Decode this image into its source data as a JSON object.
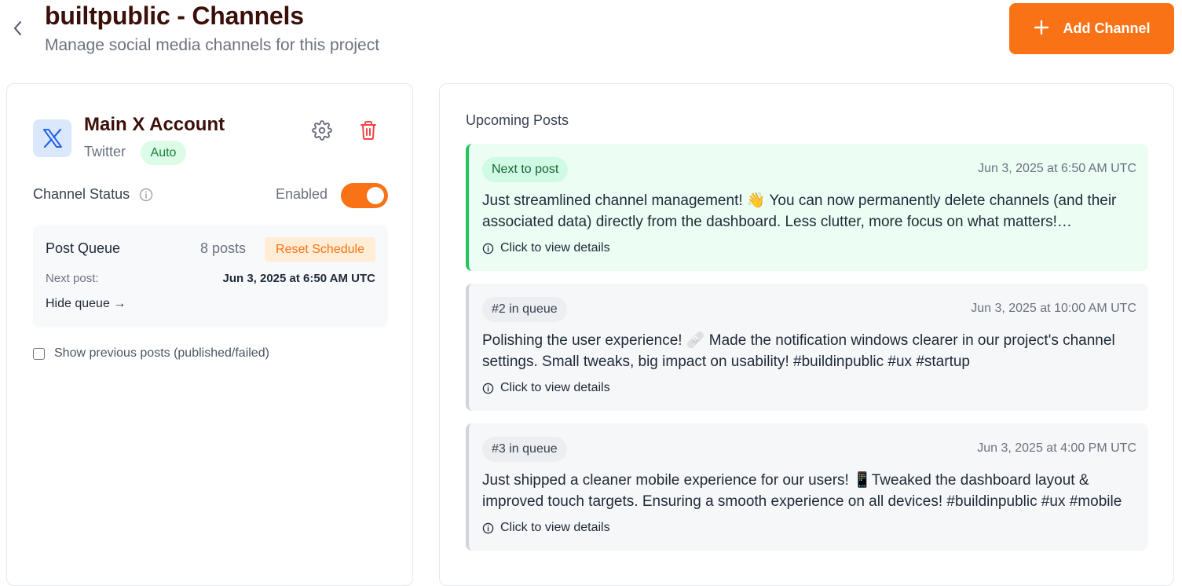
{
  "header": {
    "title": "builtpublic - Channels",
    "subtitle": "Manage social media channels for this project",
    "add_button_label": "Add Channel"
  },
  "channel": {
    "name": "Main X Account",
    "platform": "Twitter",
    "mode_badge": "Auto",
    "status_label": "Channel Status",
    "status_value": "Enabled",
    "enabled": true
  },
  "queue": {
    "title": "Post Queue",
    "count": "8 posts",
    "reset_label": "Reset Schedule",
    "next_label": "Next post:",
    "next_value": "Jun 3, 2025 at 6:50 AM UTC",
    "hide_label": "Hide queue →"
  },
  "show_previous": {
    "label": "Show previous posts (published/failed)",
    "checked": false
  },
  "upcoming": {
    "title": "Upcoming Posts",
    "details_label": "Click to view details",
    "posts": [
      {
        "badge": "Next to post",
        "time": "Jun 3, 2025 at 6:50 AM UTC",
        "text": "Just streamlined channel management! 👋 You can now permanently delete channels (and their associated data) directly from the dashboard. Less clutter, more focus on what matters! #buildinpublic"
      },
      {
        "badge": "#2 in queue",
        "time": "Jun 3, 2025 at 10:00 AM UTC",
        "text": "Polishing the user experience! 🩹 Made the notification windows clearer in our project's channel settings. Small tweaks, big impact on usability! #buildinpublic #ux #startup"
      },
      {
        "badge": "#3 in queue",
        "time": "Jun 3, 2025 at 4:00 PM UTC",
        "text": "Just shipped a cleaner mobile experience for our users! 📱Tweaked the dashboard layout & improved touch targets. Ensuring a smooth experience on all devices! #buildinpublic #ux #mobile"
      }
    ]
  },
  "colors": {
    "accent": "#f97316",
    "title": "#3b0f0a",
    "next_post_border": "#22c55e",
    "delete": "#ef4444"
  }
}
